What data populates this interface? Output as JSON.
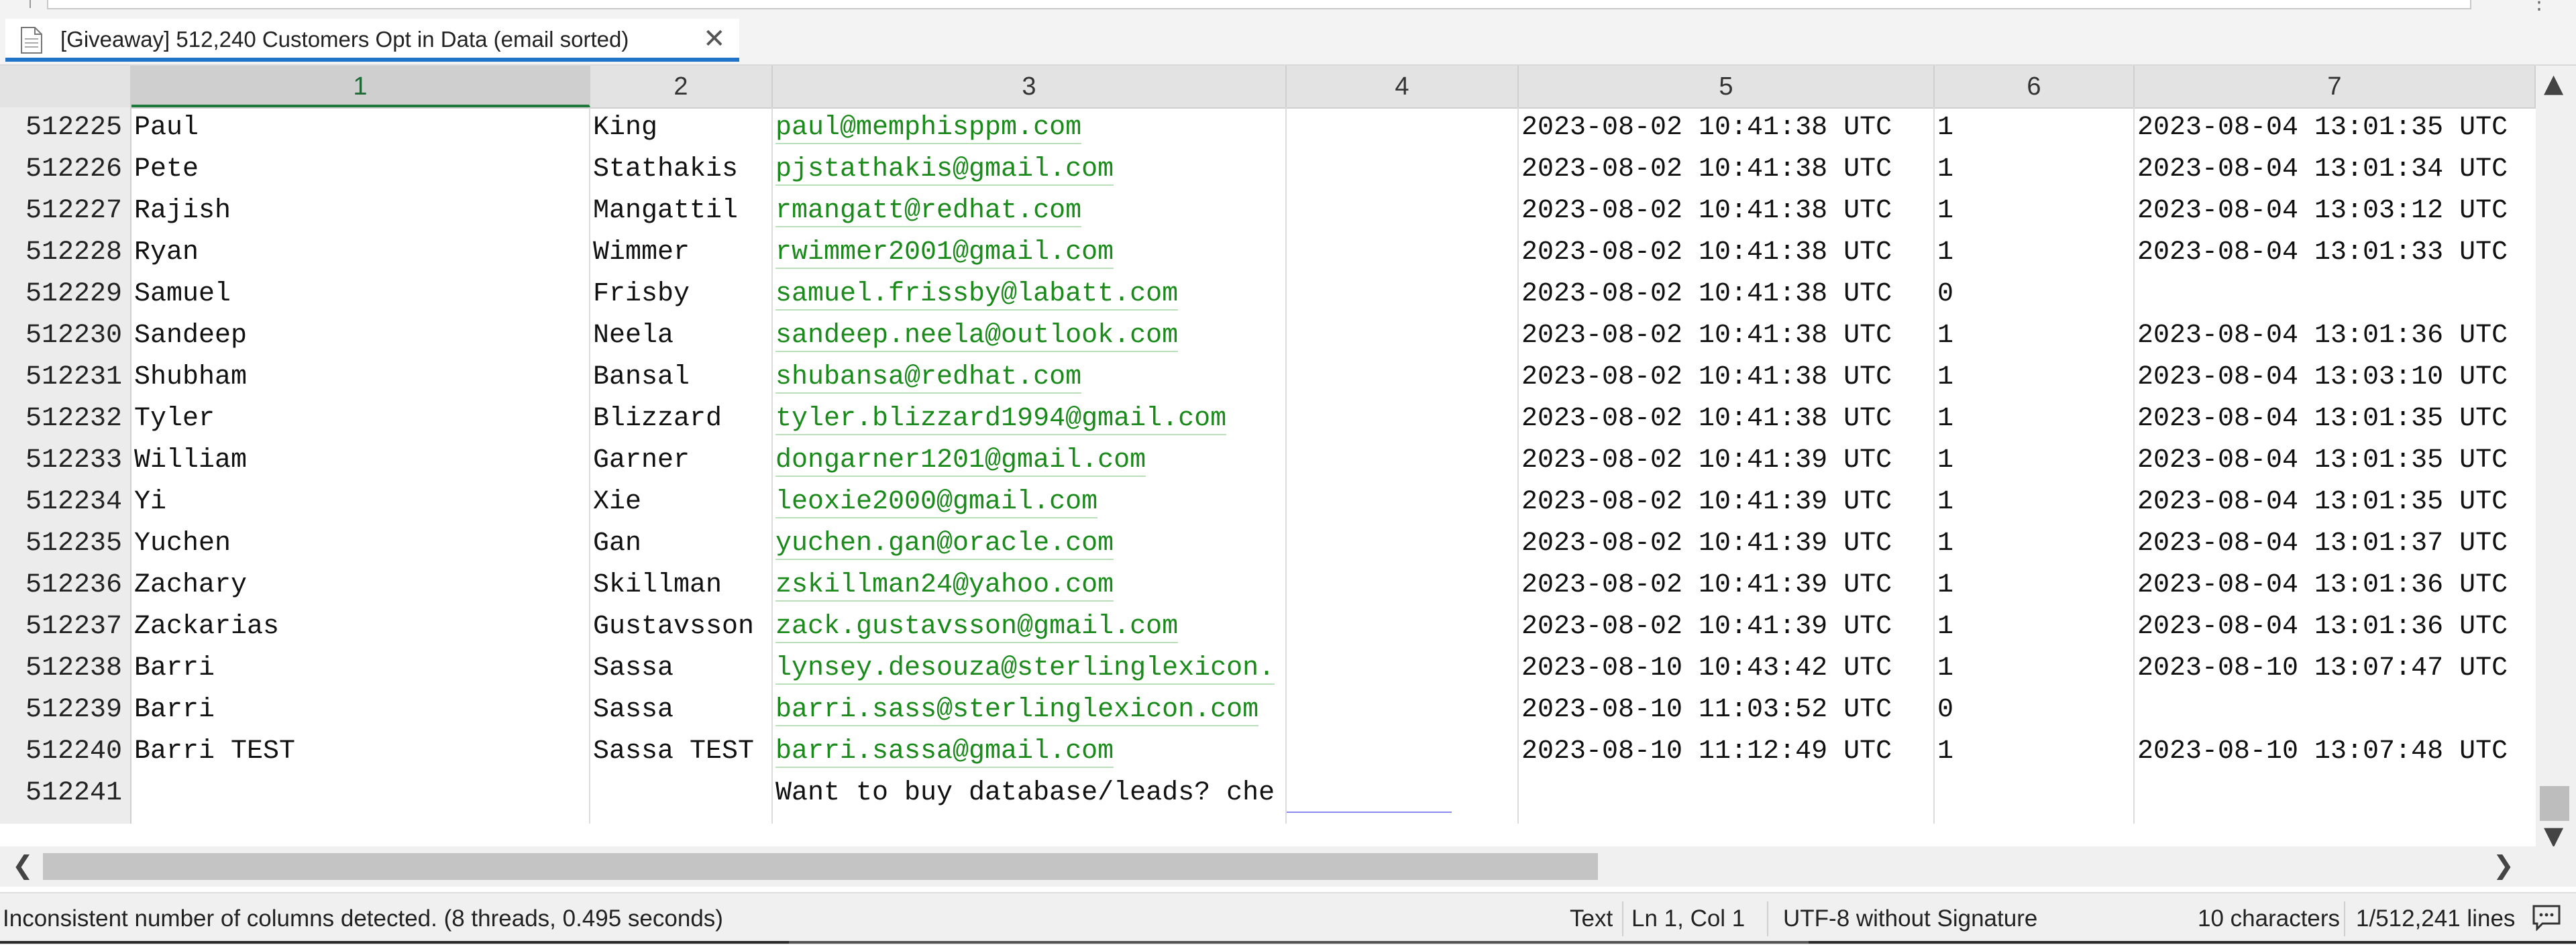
{
  "tab": {
    "title": "[Giveaway] 512,240 Customers Opt in Data (email sorted)",
    "close_glyph": "✕"
  },
  "columns": [
    "1",
    "2",
    "3",
    "4",
    "5",
    "6",
    "7"
  ],
  "rows": [
    {
      "n": "512225",
      "c1": "Paul",
      "c2": "King",
      "c3": "paul@memphisppm.com",
      "c4": "",
      "c5": "2023-08-02 10:41:38 UTC",
      "c6": "1",
      "c7": "2023-08-04 13:01:35 UTC"
    },
    {
      "n": "512226",
      "c1": "Pete",
      "c2": "Stathakis",
      "c3": "pjstathakis@gmail.com",
      "c4": "",
      "c5": "2023-08-02 10:41:38 UTC",
      "c6": "1",
      "c7": "2023-08-04 13:01:34 UTC"
    },
    {
      "n": "512227",
      "c1": "Rajish",
      "c2": "Mangattil",
      "c3": "rmangatt@redhat.com",
      "c4": "",
      "c5": "2023-08-02 10:41:38 UTC",
      "c6": "1",
      "c7": "2023-08-04 13:03:12 UTC"
    },
    {
      "n": "512228",
      "c1": "Ryan",
      "c2": "Wimmer",
      "c3": "rwimmer2001@gmail.com",
      "c4": "",
      "c5": "2023-08-02 10:41:38 UTC",
      "c6": "1",
      "c7": "2023-08-04 13:01:33 UTC"
    },
    {
      "n": "512229",
      "c1": "Samuel",
      "c2": "Frisby",
      "c3": "samuel.frissby@labatt.com",
      "c4": "",
      "c5": "2023-08-02 10:41:38 UTC",
      "c6": "0",
      "c7": ""
    },
    {
      "n": "512230",
      "c1": "Sandeep",
      "c2": "Neela",
      "c3": "sandeep.neela@outlook.com",
      "c4": "",
      "c5": "2023-08-02 10:41:38 UTC",
      "c6": "1",
      "c7": "2023-08-04 13:01:36 UTC"
    },
    {
      "n": "512231",
      "c1": "Shubham",
      "c2": "Bansal",
      "c3": "shubansa@redhat.com",
      "c4": "",
      "c5": "2023-08-02 10:41:38 UTC",
      "c6": "1",
      "c7": "2023-08-04 13:03:10 UTC"
    },
    {
      "n": "512232",
      "c1": "Tyler",
      "c2": "Blizzard",
      "c3": "tyler.blizzard1994@gmail.com",
      "c4": "",
      "c5": "2023-08-02 10:41:38 UTC",
      "c6": "1",
      "c7": "2023-08-04 13:01:35 UTC"
    },
    {
      "n": "512233",
      "c1": "William",
      "c2": "Garner",
      "c3": "dongarner1201@gmail.com",
      "c4": "",
      "c5": "2023-08-02 10:41:39 UTC",
      "c6": "1",
      "c7": "2023-08-04 13:01:35 UTC"
    },
    {
      "n": "512234",
      "c1": "Yi",
      "c2": "Xie",
      "c3": "leoxie2000@gmail.com",
      "c4": "",
      "c5": "2023-08-02 10:41:39 UTC",
      "c6": "1",
      "c7": "2023-08-04 13:01:35 UTC"
    },
    {
      "n": "512235",
      "c1": "Yuchen",
      "c2": "Gan",
      "c3": "yuchen.gan@oracle.com",
      "c4": "",
      "c5": "2023-08-02 10:41:39 UTC",
      "c6": "1",
      "c7": "2023-08-04 13:01:37 UTC"
    },
    {
      "n": "512236",
      "c1": "Zachary",
      "c2": "Skillman",
      "c3": "zskillman24@yahoo.com",
      "c4": "",
      "c5": "2023-08-02 10:41:39 UTC",
      "c6": "1",
      "c7": "2023-08-04 13:01:36 UTC"
    },
    {
      "n": "512237",
      "c1": "Zackarias",
      "c2": "Gustavsson",
      "c3": "zack.gustavsson@gmail.com",
      "c4": "",
      "c5": "2023-08-02 10:41:39 UTC",
      "c6": "1",
      "c7": "2023-08-04 13:01:36 UTC"
    },
    {
      "n": "512238",
      "c1": "Barri",
      "c2": "Sassa",
      "c3": "lynsey.desouza@sterlinglexicon.",
      "c4": "",
      "c5": "2023-08-10 10:43:42 UTC",
      "c6": "1",
      "c7": "2023-08-10 13:07:47 UTC"
    },
    {
      "n": "512239",
      "c1": "Barri",
      "c2": "Sassa",
      "c3": "barri.sass@sterlinglexicon.com",
      "c4": "",
      "c5": "2023-08-10 11:03:52 UTC",
      "c6": "0",
      "c7": ""
    },
    {
      "n": "512240",
      "c1": "Barri TEST",
      "c2": "Sassa TEST",
      "c3": "barri.sassa@gmail.com",
      "c4": "",
      "c5": "2023-08-10 11:12:49 UTC",
      "c6": "1",
      "c7": "2023-08-10 13:07:48 UTC"
    },
    {
      "n": "512241",
      "c1": "",
      "c2": "",
      "c3": "Want to buy database/leads? che",
      "c4": "",
      "c5": "",
      "c6": "",
      "c7": ""
    }
  ],
  "email_rows_last_index": 15,
  "scroll": {
    "up": "▲",
    "down": "▼",
    "left": "❮",
    "right": "❯"
  },
  "status": {
    "message": "Inconsistent number of columns detected. (8 threads, 0.495 seconds)",
    "type": "Text",
    "position": "Ln 1, Col 1",
    "encoding": "UTF-8 without Signature",
    "chars": "10 characters",
    "lines": "1/512,241 lines"
  },
  "icons": {
    "tab": "document-icon",
    "feedback": "feedback-icon"
  }
}
